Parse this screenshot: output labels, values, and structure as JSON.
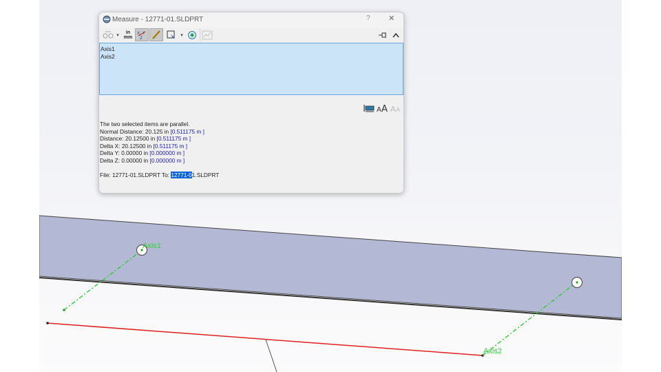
{
  "dialog": {
    "title": "Measure - 12771-01.SLDPRT",
    "help_label": "?",
    "close_label": "✕",
    "toolbar": {
      "units_in": "in",
      "units_mm": "mm"
    },
    "selections": [
      "Axis1",
      "Axis2"
    ],
    "results": {
      "parallel_text": "The two selected items are parallel.",
      "normal_distance_label": "Normal Distance: 20.125 in",
      "normal_distance_metric": "[0.511175 m ]",
      "distance_label": "Distance: 20.12500 in",
      "distance_metric": "[0.511175 m ]",
      "delta_x_label": "Delta X: 20.12500 in",
      "delta_x_metric": "[0.511175 m ]",
      "delta_y_label": "Delta Y: 0.00000 in",
      "delta_y_metric": "[0.000000 m ]",
      "delta_z_label": "Delta Z: 0.00000 in",
      "delta_z_metric": "[0.000000 m ]",
      "file_prefix": "File: 12771-01.SLDPRT To:",
      "file_highlight": "12771-0",
      "file_suffix": "1.SLDPRT"
    }
  },
  "scene": {
    "axis1_label": "Axis1",
    "axis2_label": "Axis2",
    "colors": {
      "plate": "#b3b8d5",
      "axis": "#22cc22",
      "edge": "#e02020"
    }
  }
}
